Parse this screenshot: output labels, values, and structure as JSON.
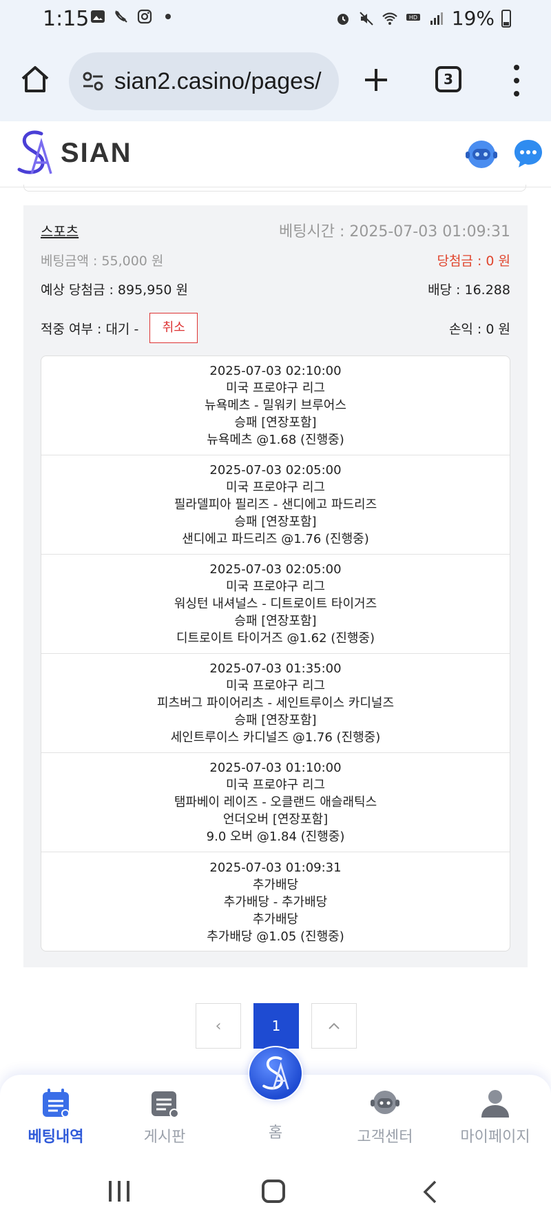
{
  "status_bar": {
    "time": "1:15",
    "battery": "19%"
  },
  "browser": {
    "url": "sian2.casino/pages/",
    "tab_count": "3"
  },
  "site": {
    "logo_text": "SIAN"
  },
  "bet": {
    "category": "스포츠",
    "bet_time": "베팅시간 : 2025-07-03 01:09:31",
    "bet_amount": "베팅금액 : 55,000 원",
    "win_amount": "당첨금 : 0 원",
    "expected_win": "예상 당첨금 : 895,950 원",
    "odds": "배당 : 16.288",
    "hit_status": "적중 여부 : 대기 -",
    "cancel_label": "취소",
    "profit": "손익 : 0 원",
    "items": [
      {
        "time": "2025-07-03 02:10:00",
        "league": "미국 프로야구 리그",
        "match": "뉴욕메츠 - 밀워키 브루어스",
        "market": "승패 [연장포함]",
        "pick": "뉴욕메츠 @1.68 (진행중)"
      },
      {
        "time": "2025-07-03 02:05:00",
        "league": "미국 프로야구 리그",
        "match": "필라델피아 필리즈 - 샌디에고 파드리즈",
        "market": "승패 [연장포함]",
        "pick": "샌디에고 파드리즈 @1.76 (진행중)"
      },
      {
        "time": "2025-07-03 02:05:00",
        "league": "미국 프로야구 리그",
        "match": "워싱턴 내셔널스 - 디트로이트 타이거즈",
        "market": "승패 [연장포함]",
        "pick": "디트로이트 타이거즈 @1.62 (진행중)"
      },
      {
        "time": "2025-07-03 01:35:00",
        "league": "미국 프로야구 리그",
        "match": "피츠버그 파이어리츠 - 세인트루이스 카디널즈",
        "market": "승패 [연장포함]",
        "pick": "세인트루이스 카디널즈 @1.76 (진행중)"
      },
      {
        "time": "2025-07-03 01:10:00",
        "league": "미국 프로야구 리그",
        "match": "탬파베이 레이즈 - 오클랜드 애슬래틱스",
        "market": "언더오버 [연장포함]",
        "pick": "9.0 오버 @1.84 (진행중)"
      },
      {
        "time": "2025-07-03 01:09:31",
        "league": "추가배당",
        "match": "추가배당 - 추가배당",
        "market": "추가배당",
        "pick": "추가배당 @1.05 (진행중)"
      }
    ]
  },
  "pagination": {
    "prev": "‹",
    "current": "1",
    "up": "^"
  },
  "bottom_nav": {
    "betting_history": "베팅내역",
    "board": "게시판",
    "home": "홈",
    "support": "고객센터",
    "mypage": "마이페이지"
  },
  "colors": {
    "accent": "#2f5ad9",
    "win_red": "#e0452d",
    "cancel_red": "#dd3333"
  }
}
